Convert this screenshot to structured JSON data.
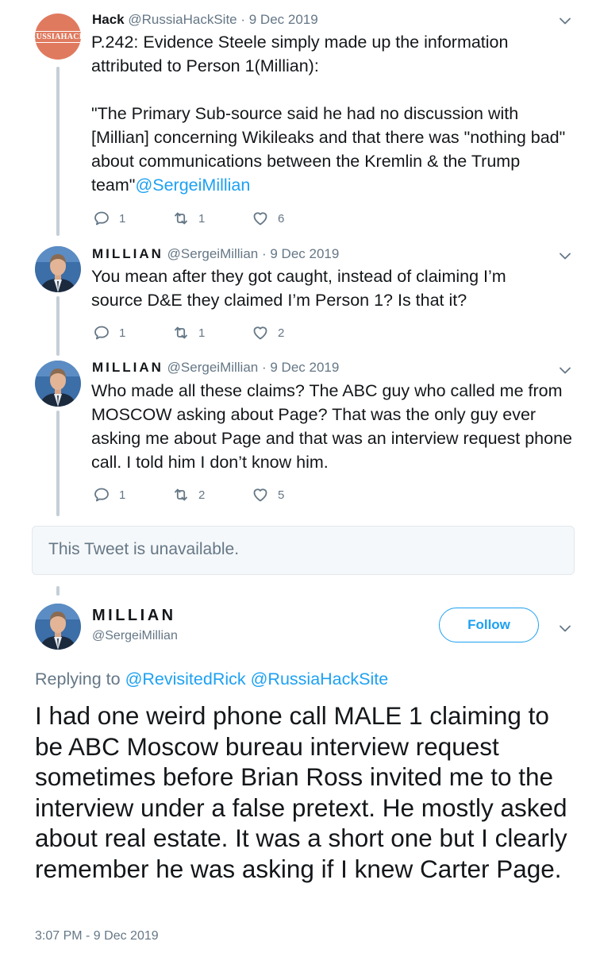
{
  "tweets": [
    {
      "display_name": "Hack",
      "handle": "@RussiaHackSite",
      "date": "· 9 Dec 2019",
      "avatar_text": "RUSSIAHACK",
      "text": "P.242: Evidence Steele simply made up the information attributed to Person 1(Millian):\n\n\"The Primary Sub-source said he had no discussion with [Millian] concerning Wikileaks and that there was \"nothing bad\" about communications between the Kremlin & the Trump team\"",
      "mention": "@SergeiMillian",
      "replies": "1",
      "retweets": "1",
      "likes": "6"
    },
    {
      "display_name": "MILLIAN",
      "handle": "@SergeiMillian",
      "date": "· 9 Dec 2019",
      "text": "You mean after they got caught, instead of claiming I’m source D&E they claimed I’m Person 1? Is that it?",
      "replies": "1",
      "retweets": "1",
      "likes": "2"
    },
    {
      "display_name": "MILLIAN",
      "handle": "@SergeiMillian",
      "date": "· 9 Dec 2019",
      "text": "Who made all these claims? The ABC guy who called me from MOSCOW asking about Page? That was the only guy ever asking me about Page and that was an interview request phone call. I told him I don’t know him.",
      "replies": "1",
      "retweets": "2",
      "likes": "5"
    }
  ],
  "unavailable_text": "This Tweet is unavailable.",
  "main_tweet": {
    "display_name": "MILLIAN",
    "handle": "@SergeiMillian",
    "follow_label": "Follow",
    "replying_prefix": "Replying to",
    "replying_to": [
      "@RevisitedRick",
      "@RussiaHackSite"
    ],
    "text": "I had one weird phone call MALE 1 claiming to be ABC Moscow bureau interview request sometimes before Brian Ross invited me to the interview under a false pretext. He mostly asked about real estate. It was a short one but I clearly remember he was asking if I knew Carter Page.",
    "timestamp": "3:07 PM - 9 Dec 2019"
  },
  "icons": [
    "reply-icon",
    "retweet-icon",
    "like-icon",
    "chevron-down-icon"
  ],
  "colors": {
    "accent": "#1da1f2",
    "text": "#14171a",
    "muted": "#657786",
    "thread_line": "#c4cfd6"
  }
}
